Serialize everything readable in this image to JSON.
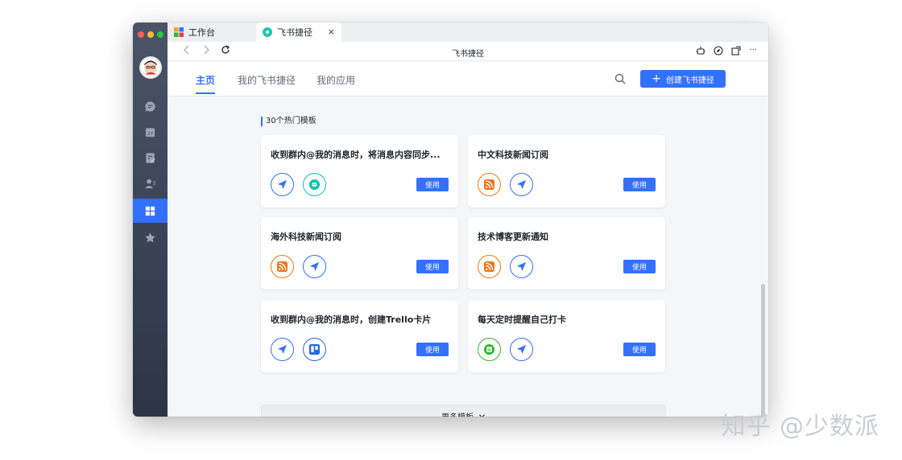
{
  "tabs": [
    {
      "label": "工作台",
      "icon": "grid-apps-icon"
    },
    {
      "label": "飞书捷径",
      "icon": "shortcut-app-icon",
      "close": "×"
    }
  ],
  "navbar": {
    "title": "飞书捷径",
    "back_icon": "chevron-left-icon",
    "forward_icon": "chevron-right-icon",
    "refresh_icon": "refresh-icon",
    "right_icons": [
      "robot-icon",
      "compass-icon",
      "open-window-icon",
      "more-icon"
    ],
    "more_label": "···"
  },
  "header": {
    "tabs": [
      "主页",
      "我的飞书捷径",
      "我的应用"
    ],
    "active_tab": "主页",
    "create_button": "创建飞书捷径",
    "create_plus": "+"
  },
  "section": {
    "title": "30个热门模板"
  },
  "cards": [
    {
      "title": "收到群内@我的消息时，将消息内容同步...",
      "icons": [
        "send-icon",
        "bot-icon"
      ],
      "button": "使用"
    },
    {
      "title": "中文科技新闻订阅",
      "icons": [
        "rss-icon",
        "send-icon"
      ],
      "button": "使用"
    },
    {
      "title": "海外科技新闻订阅",
      "icons": [
        "rss-icon",
        "send-icon"
      ],
      "button": "使用"
    },
    {
      "title": "技术博客更新通知",
      "icons": [
        "rss-icon",
        "send-icon"
      ],
      "button": "使用"
    },
    {
      "title": "收到群内@我的消息时，创建Trello卡片",
      "icons": [
        "send-icon",
        "trello-icon"
      ],
      "button": "使用"
    },
    {
      "title": "每天定时提醒自己打卡",
      "icons": [
        "calendar-icon",
        "send-icon"
      ],
      "button": "使用"
    }
  ],
  "more_button": "更多模板",
  "sidebar": {
    "items": [
      "chat-icon",
      "calendar-icon",
      "docs-icon",
      "contacts-icon",
      "workplace-icon",
      "favorites-icon"
    ],
    "active": "workplace-icon"
  },
  "watermark": "知乎 @少数派",
  "colors": {
    "accent": "#3370ff",
    "rss": "#f0761b",
    "bot": "#14c0a8",
    "calendar": "#2eb82e"
  }
}
